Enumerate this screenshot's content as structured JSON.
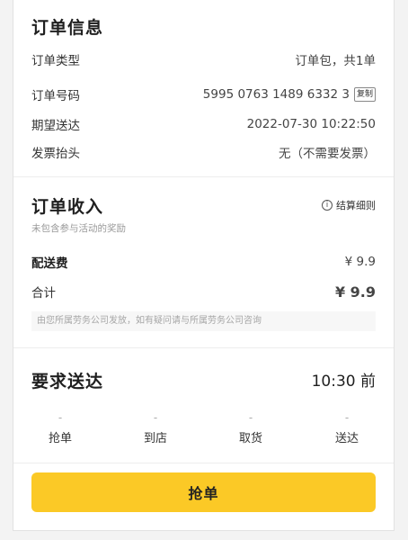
{
  "order_info": {
    "title": "订单信息",
    "rows": [
      {
        "label": "订单类型",
        "value": "订单包，共1单"
      },
      {
        "label": "订单号码",
        "value": "5995 0763 1489 6332 3"
      },
      {
        "label": "期望送达",
        "value": "2022-07-30 10:22:50"
      },
      {
        "label": "发票抬头",
        "value": "无（不需要发票）"
      }
    ],
    "copy_label": "复制"
  },
  "income": {
    "title": "订单收入",
    "subtitle": "未包含参与活动的奖励",
    "rules_label": "结算细则",
    "delivery_fee_label": "配送费",
    "delivery_fee_value": "¥ 9.9",
    "total_label": "合计",
    "total_value": "¥ 9.9",
    "notice": "由您所属劳务公司发放，如有疑问请与所属劳务公司咨询"
  },
  "delivery": {
    "title": "要求送达",
    "deadline": "10:30 前",
    "steps": [
      {
        "time": "-",
        "label": "抢单"
      },
      {
        "time": "-",
        "label": "到店"
      },
      {
        "time": "-",
        "label": "取货"
      },
      {
        "time": "-",
        "label": "送达"
      }
    ]
  },
  "action": {
    "grab_label": "抢单"
  },
  "colors": {
    "accent_yellow": "#fbc926",
    "total_orange": "#f48a1c"
  }
}
